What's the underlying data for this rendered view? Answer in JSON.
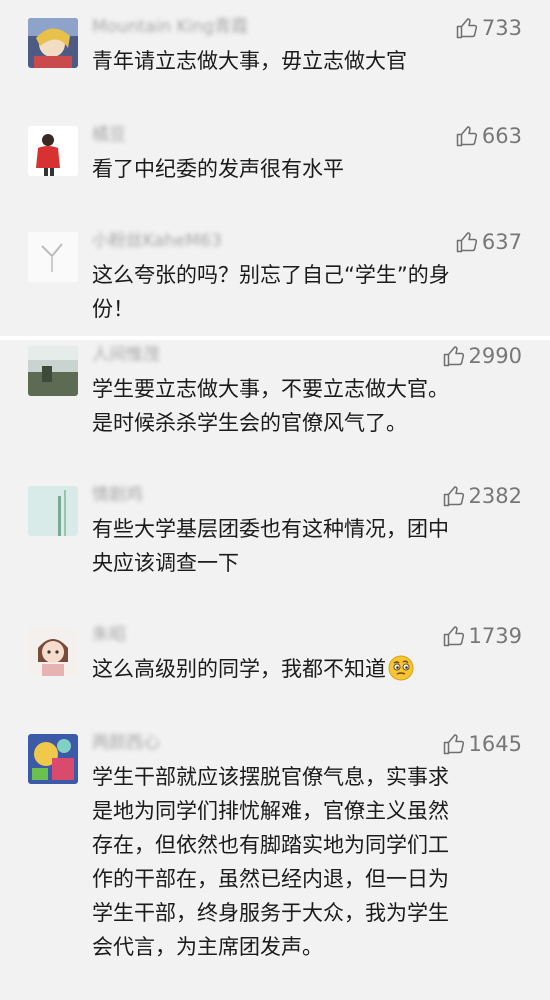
{
  "colors": {
    "panel": "#f2f2f2",
    "like": "#6f6f6f",
    "nickname": "#a8a8a8",
    "text": "#1b1b1b"
  },
  "comments": [
    {
      "nickname": "Mountain King青霞",
      "likes": "733",
      "lines": [
        "青年请立志做大事，毋立志做大官"
      ],
      "avatar": "anime-avatar"
    },
    {
      "nickname": "橘豆",
      "likes": "663",
      "lines": [
        "看了中纪委的发声很有水平"
      ],
      "avatar": "red-figure-avatar"
    },
    {
      "nickname": "小粉丝KaheM63",
      "likes": "637",
      "lines": [
        "这么夸张的吗？别忘了自己“学生”的身",
        "份！"
      ],
      "avatar": "white-avatar"
    },
    {
      "nickname": "人间惟茂",
      "likes": "2990",
      "lines": [
        "学生要立志做大事，不要立志做大官。",
        "是时候杀杀学生会的官僚风气了。"
      ],
      "avatar": "landscape-avatar"
    },
    {
      "nickname": "情剧鸡",
      "likes": "2382",
      "lines": [
        "有些大学基层团委也有这种情况，团中",
        "央应该调查一下"
      ],
      "avatar": "plant-avatar"
    },
    {
      "nickname": "朱昭",
      "likes": "1739",
      "lines": [
        "这么高级别的同学，我都不知道"
      ],
      "emoji": "thinking-face-emoji",
      "avatar": "cartoon-girl-avatar"
    },
    {
      "nickname": "两颜西心",
      "likes": "1645",
      "lines": [
        "学生干部就应该摆脱官僚气息，实事求",
        "是地为同学们排忧解难，官僚主义虽然",
        "存在，但依然也有脚踏实地为同学们工",
        "作的干部在，虽然已经内退，但一日为",
        "学生干部，终身服务于大众，我为学生",
        "会代言，为主席团发声。"
      ],
      "avatar": "colorful-avatar"
    }
  ]
}
